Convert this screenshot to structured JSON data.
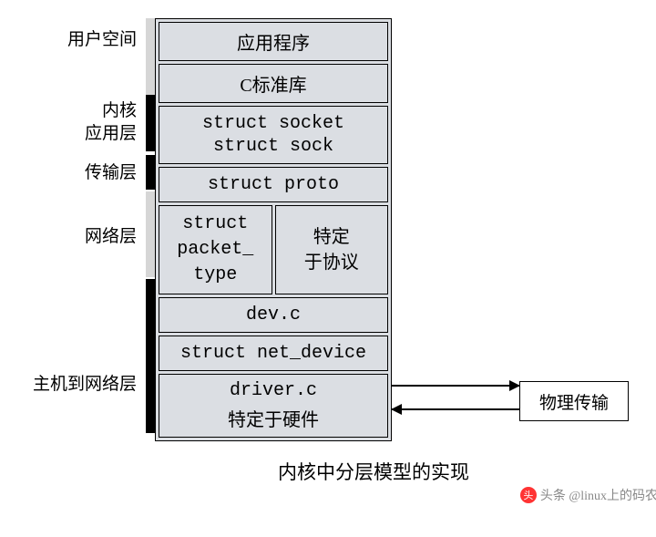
{
  "labels": {
    "user_space": "用户空间",
    "kernel_app": "内核\n应用层",
    "transport": "传输层",
    "network": "网络层",
    "host_net": "主机到网络层"
  },
  "stack": {
    "app": "应用程序",
    "clib": "C标准库",
    "socket_line1": "struct socket",
    "socket_line2": "struct sock",
    "proto": "struct proto",
    "packet_type": "struct\npacket_\ntype",
    "proto_specific": "特定\n于协议",
    "devc": "dev.c",
    "netdev": "struct net_device",
    "driver": "driver.c",
    "hw_specific": "特定于硬件"
  },
  "phys": "物理传输",
  "caption": "内核中分层模型的实现",
  "watermark": "头条 @linux上的码农"
}
